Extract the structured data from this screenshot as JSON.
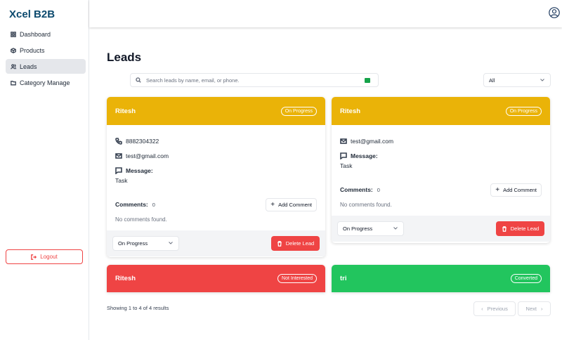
{
  "brand": "Xcel B2B",
  "sidebar": {
    "items": [
      {
        "label": "Dashboard",
        "icon": "dashboard-icon"
      },
      {
        "label": "Products",
        "icon": "box-icon"
      },
      {
        "label": "Leads",
        "icon": "users-icon",
        "active": true
      },
      {
        "label": "Category Manage",
        "icon": "folder-icon"
      }
    ],
    "logout": "Logout"
  },
  "page": {
    "title": "Leads",
    "search_placeholder": "Search leads by name, email, or phone.",
    "filter_value": "All"
  },
  "colors": {
    "on_progress": "#eab308",
    "not_interested": "#ef4444",
    "converted": "#22c55e",
    "brand": "#0c4a6e"
  },
  "cards": [
    {
      "name": "Ritesh",
      "status": "On Progress",
      "phone": "8882304322",
      "email": "test@gmail.com",
      "message_label": "Message:",
      "message": "Task",
      "comments_label": "Comments:",
      "comments_count": "0",
      "add_comment": "Add Comment",
      "no_comments": "No comments found.",
      "select_value": "On Progress",
      "delete": "Delete Lead"
    },
    {
      "name": "Ritesh",
      "status": "On Progress",
      "email": "test@gmail.com",
      "message_label": "Message:",
      "message": "Task",
      "comments_label": "Comments:",
      "comments_count": "0",
      "add_comment": "Add Comment",
      "no_comments": "No comments found.",
      "select_value": "On Progress",
      "delete": "Delete Lead"
    },
    {
      "name": "Ritesh",
      "status": "Not Interested"
    },
    {
      "name": "tri",
      "status": "Converted"
    }
  ],
  "pagination": {
    "summary": "Showing 1 to 4 of 4 results",
    "previous": "Previous",
    "next": "Next"
  }
}
